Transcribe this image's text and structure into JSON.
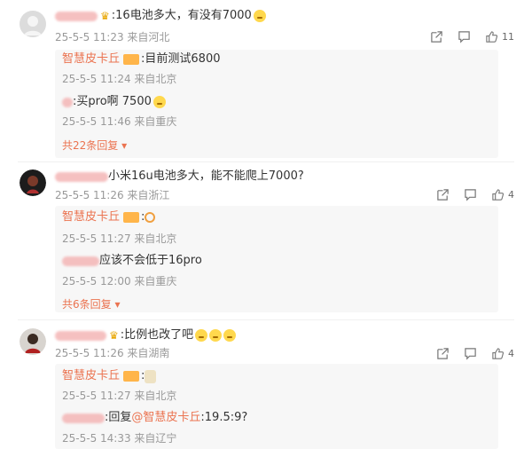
{
  "threads": [
    {
      "text": ":16电池多大，有没有7000",
      "meta": "25-5-5 11:23 来自河北",
      "like_count": "11",
      "replies": [
        {
          "author": "智慧皮卡丘",
          "text": ":目前测试6800",
          "meta": "25-5-5 11:24 来自北京"
        },
        {
          "author": "",
          "text": ":买pro啊  7500",
          "meta": "25-5-5 11:46 来自重庆"
        }
      ],
      "more": "共22条回复"
    },
    {
      "text": "小米16u电池多大，能不能爬上7000?",
      "meta": "25-5-5 11:26 来自浙江",
      "like_count": "4",
      "replies": [
        {
          "author": "智慧皮卡丘",
          "text": ":",
          "meta": "25-5-5 11:27 来自北京"
        },
        {
          "author": "",
          "text": "应该不会低于16pro",
          "meta": "25-5-5 12:00 来自重庆"
        }
      ],
      "more": "共6条回复"
    },
    {
      "text": ":比例也改了吧",
      "meta": "25-5-5 11:26 来自湖南",
      "like_count": "4",
      "replies": [
        {
          "author": "智慧皮卡丘",
          "text": ":",
          "meta": "25-5-5 11:27 来自北京"
        },
        {
          "author": "",
          "text": ":回复",
          "mention": "@智慧皮卡丘",
          "text2": ":19.5:9?",
          "meta": "25-5-5 14:33 来自辽宁"
        }
      ]
    }
  ],
  "colors": {
    "accent": "#eb7350",
    "meta": "#999999",
    "reply_bg": "#f7f7f7"
  }
}
